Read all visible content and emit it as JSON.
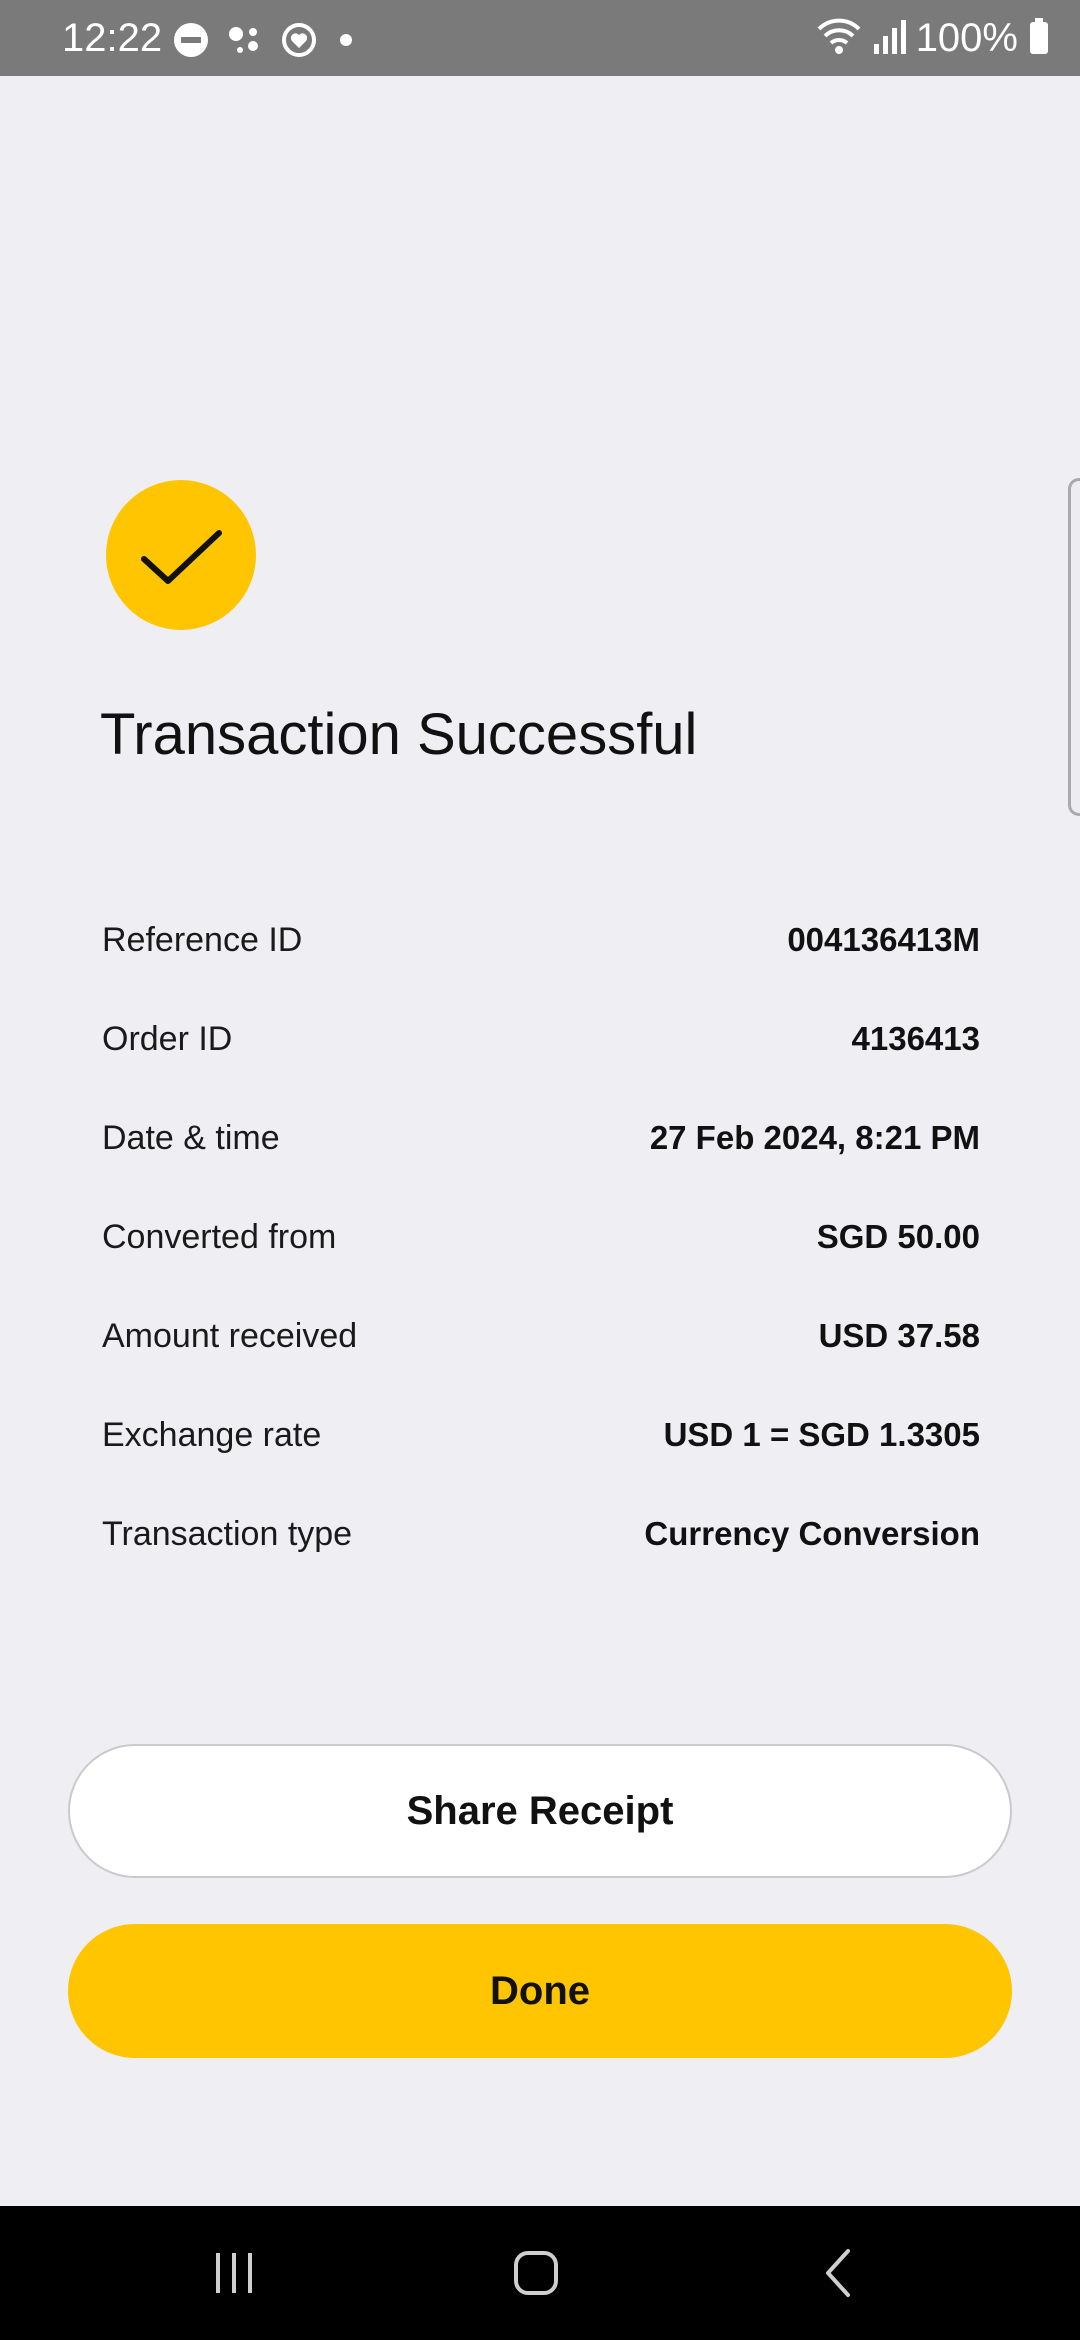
{
  "status_bar": {
    "time": "12:22",
    "battery": "100%",
    "icons": [
      "do-not-disturb-icon",
      "dots-icon",
      "heart-sync-icon",
      "notification-dot-icon",
      "wifi-icon",
      "signal-icon",
      "battery-icon"
    ]
  },
  "success": {
    "icon": "checkmark-icon",
    "title": "Transaction Successful"
  },
  "details": [
    {
      "label": "Reference ID",
      "value": "004136413M"
    },
    {
      "label": "Order ID",
      "value": "4136413"
    },
    {
      "label": "Date & time",
      "value": "27 Feb 2024, 8:21 PM"
    },
    {
      "label": "Converted from",
      "value": "SGD 50.00"
    },
    {
      "label": "Amount received",
      "value": "USD 37.58"
    },
    {
      "label": "Exchange rate",
      "value": "USD 1 = SGD 1.3305"
    },
    {
      "label": "Transaction type",
      "value": "Currency Conversion"
    }
  ],
  "buttons": {
    "share_label": "Share Receipt",
    "done_label": "Done"
  },
  "nav_bar": {
    "icons": [
      "recent-apps-icon",
      "home-icon",
      "back-icon"
    ]
  },
  "colors": {
    "accent": "#FFC500",
    "background": "#EFEEF3",
    "status_bar": "#7A7A7A"
  }
}
